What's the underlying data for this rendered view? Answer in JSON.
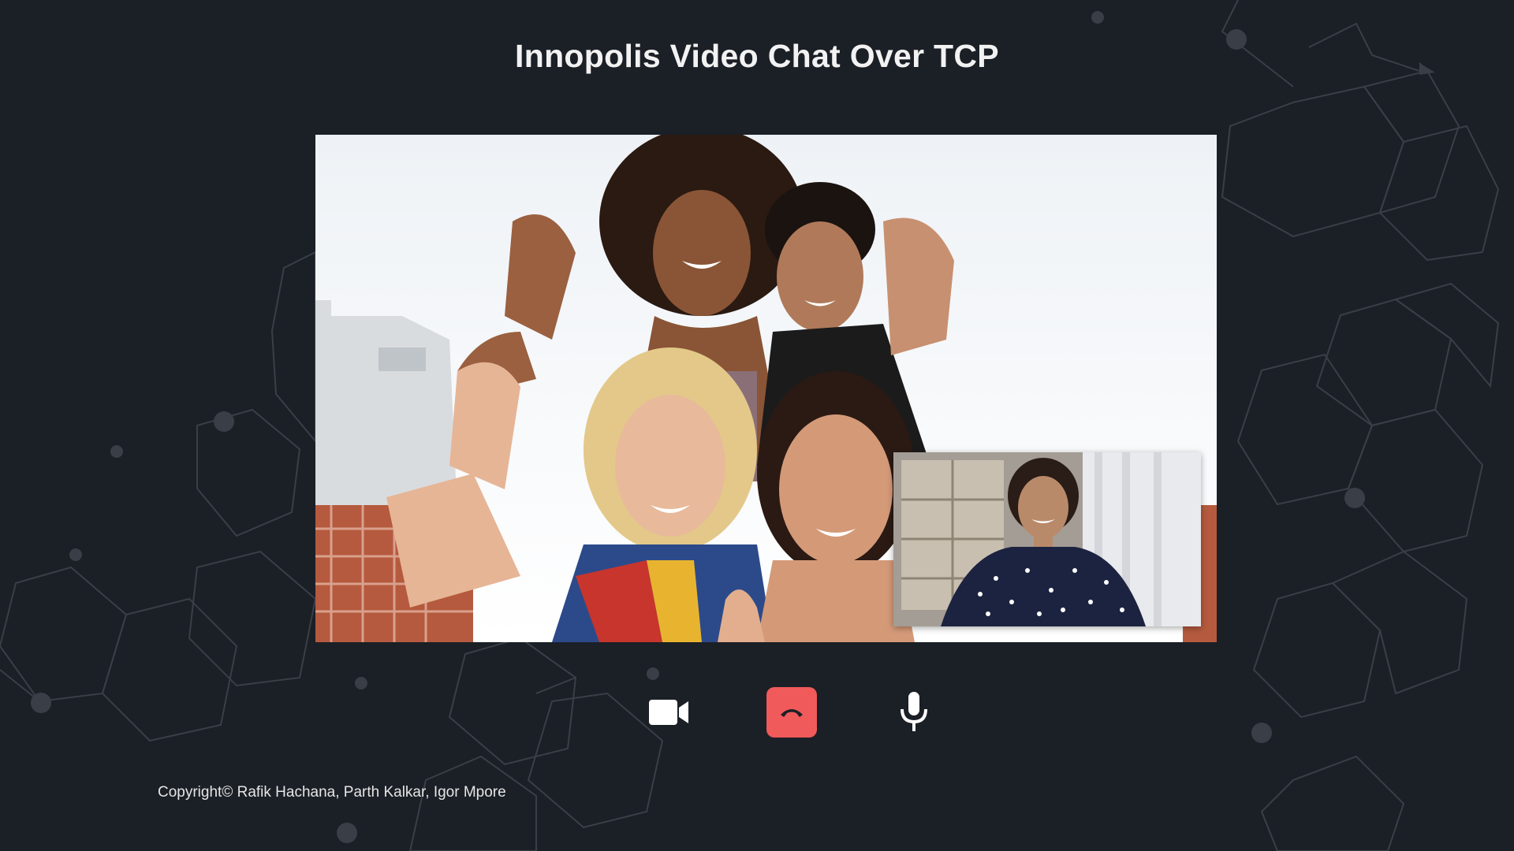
{
  "page": {
    "title": "Innopolis Video Chat Over TCP"
  },
  "video": {
    "remote_feed": "group-of-friends-waving",
    "local_feed": "self-view-woman-polka-dot-shirt"
  },
  "controls": {
    "camera_icon": "video-camera-icon",
    "hangup_icon": "phone-hangup-icon",
    "mic_icon": "microphone-icon"
  },
  "footer": {
    "copyright": "Copyright© Rafik Hachana, Parth Kalkar, Igor Mpore"
  },
  "colors": {
    "background": "#1b1f26",
    "hangup": "#f05a5a",
    "text": "#f2f2f2"
  }
}
